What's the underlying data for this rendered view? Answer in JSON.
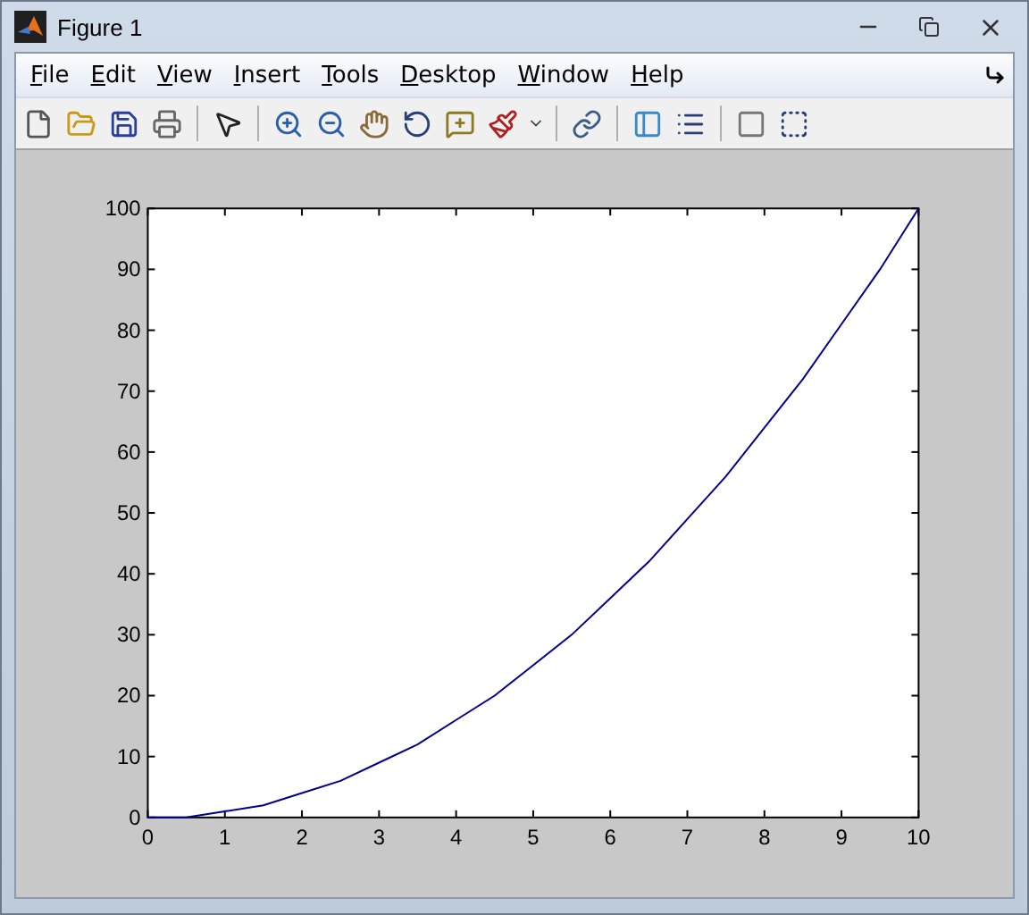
{
  "window": {
    "title": "Figure 1"
  },
  "menu": [
    {
      "label": "File"
    },
    {
      "label": "Edit"
    },
    {
      "label": "View"
    },
    {
      "label": "Insert"
    },
    {
      "label": "Tools"
    },
    {
      "label": "Desktop"
    },
    {
      "label": "Window"
    },
    {
      "label": "Help"
    }
  ],
  "figure": {
    "chart_data": {
      "type": "line",
      "x": [
        0,
        0.5,
        1,
        1.5,
        2,
        2.5,
        3,
        3.5,
        4,
        4.5,
        5,
        5.5,
        6,
        6.5,
        7,
        7.5,
        8,
        8.5,
        9,
        9.5,
        10
      ],
      "series": [
        {
          "color": "#00008b",
          "values": [
            0,
            0,
            1,
            2,
            4,
            6,
            9,
            12,
            16,
            20,
            25,
            30,
            36,
            42,
            49,
            56,
            64,
            72,
            81,
            90,
            100
          ]
        }
      ],
      "xlim": [
        0,
        10
      ],
      "ylim": [
        0,
        100
      ],
      "xticks": [
        0,
        1,
        2,
        3,
        4,
        5,
        6,
        7,
        8,
        9,
        10
      ],
      "yticks": [
        0,
        10,
        20,
        30,
        40,
        50,
        60,
        70,
        80,
        90,
        100
      ]
    }
  }
}
